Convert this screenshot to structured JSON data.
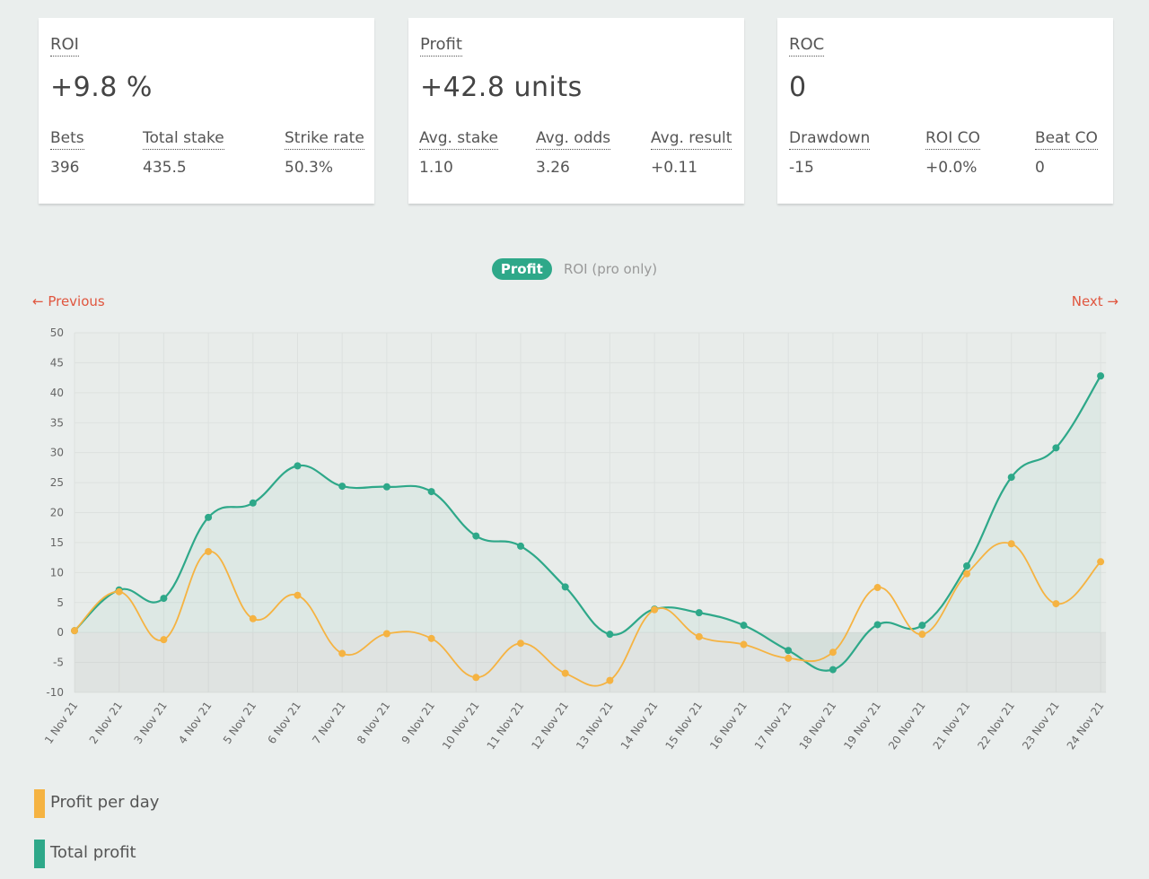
{
  "cards": [
    {
      "title": "ROI",
      "value": "+9.8 %",
      "stats": [
        {
          "label": "Bets",
          "value": "396"
        },
        {
          "label": "Total stake",
          "value": "435.5"
        },
        {
          "label": "Strike rate",
          "value": "50.3%"
        }
      ]
    },
    {
      "title": "Profit",
      "value": "+42.8 units",
      "stats": [
        {
          "label": "Avg. stake",
          "value": "1.10"
        },
        {
          "label": "Avg. odds",
          "value": "3.26"
        },
        {
          "label": "Avg. result",
          "value": "+0.11"
        }
      ]
    },
    {
      "title": "ROC",
      "value": "0",
      "stats": [
        {
          "label": "Drawdown",
          "value": "-15"
        },
        {
          "label": "ROI CO",
          "value": "+0.0%"
        },
        {
          "label": "Beat CO",
          "value": "0"
        }
      ]
    }
  ],
  "toggle": {
    "active": "Profit",
    "inactive": "ROI (pro only)"
  },
  "nav": {
    "previous": "← Previous",
    "next": "Next →"
  },
  "colors": {
    "teal": "#2ea889",
    "orange": "#f5b342",
    "accent_red": "#e0563f"
  },
  "chart_data": {
    "type": "line",
    "x": [
      "1 Nov 21",
      "2 Nov 21",
      "3 Nov 21",
      "4 Nov 21",
      "5 Nov 21",
      "6 Nov 21",
      "7 Nov 21",
      "8 Nov 21",
      "9 Nov 21",
      "10 Nov 21",
      "11 Nov 21",
      "12 Nov 21",
      "13 Nov 21",
      "14 Nov 21",
      "15 Nov 21",
      "16 Nov 21",
      "17 Nov 21",
      "18 Nov 21",
      "19 Nov 21",
      "20 Nov 21",
      "21 Nov 21",
      "22 Nov 21",
      "23 Nov 21",
      "24 Nov 21"
    ],
    "series": [
      {
        "name": "Profit per day",
        "color": "#f5b342",
        "values": [
          0.3,
          6.8,
          -1.2,
          13.5,
          2.3,
          6.2,
          -3.5,
          -0.2,
          -1.0,
          -7.5,
          -1.8,
          -6.8,
          -8.0,
          3.8,
          -0.7,
          -2.0,
          -4.3,
          -3.3,
          7.5,
          -0.3,
          9.8,
          14.8,
          4.8,
          11.8
        ]
      },
      {
        "name": "Total profit",
        "color": "#2ea889",
        "values": [
          0.3,
          7.1,
          5.7,
          19.2,
          21.6,
          27.8,
          24.4,
          24.3,
          23.5,
          16.1,
          14.4,
          7.6,
          -0.3,
          3.9,
          3.3,
          1.2,
          -3.0,
          -6.2,
          1.3,
          1.2,
          11.1,
          25.9,
          30.8,
          42.8
        ]
      }
    ],
    "ylim": [
      -10,
      50
    ],
    "yticks": [
      -10,
      -5,
      0,
      5,
      10,
      15,
      20,
      25,
      30,
      35,
      40,
      45,
      50
    ],
    "grid": true,
    "legend_position": "bottom-left"
  }
}
